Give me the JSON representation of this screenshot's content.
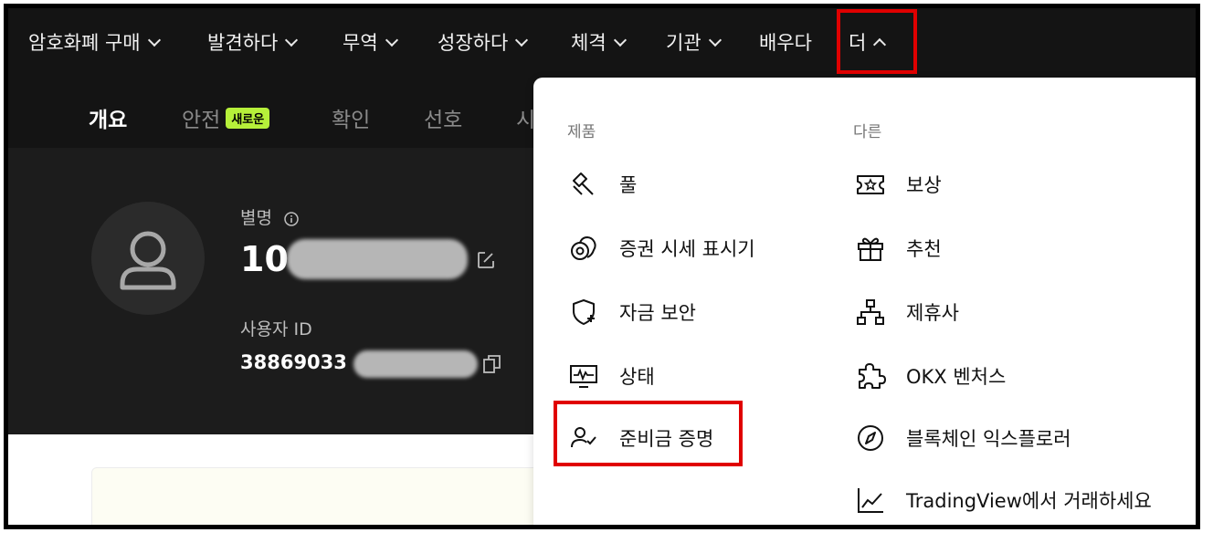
{
  "nav": {
    "items": [
      {
        "label": "암호화폐 구매",
        "chevron": "down"
      },
      {
        "label": "발견하다",
        "chevron": "down"
      },
      {
        "label": "무역",
        "chevron": "down"
      },
      {
        "label": "성장하다",
        "chevron": "down"
      },
      {
        "label": "체격",
        "chevron": "down"
      },
      {
        "label": "기관",
        "chevron": "down"
      },
      {
        "label": "배우다",
        "chevron": ""
      },
      {
        "label": "더",
        "chevron": "up"
      }
    ]
  },
  "subnav": {
    "tabs": [
      {
        "label": "개요",
        "active": true
      },
      {
        "label": "안전",
        "badge": "새로운"
      },
      {
        "label": "확인"
      },
      {
        "label": "선호"
      },
      {
        "label": "시"
      }
    ]
  },
  "profile": {
    "nickname_label": "별명",
    "nickname_value": "10",
    "user_id_label": "사용자 ID",
    "user_id_value": "38869033",
    "info_icon": "info-icon",
    "edit_icon": "edit-icon",
    "copy_icon": "copy-icon"
  },
  "dropdown": {
    "products_title": "제품",
    "other_title": "다른",
    "products": [
      {
        "label": "풀",
        "icon": "pickaxe-icon"
      },
      {
        "label": "증권 시세 표시기",
        "icon": "coins-icon"
      },
      {
        "label": "자금 보안",
        "icon": "shield-plus-icon"
      },
      {
        "label": "상태",
        "icon": "monitor-pulse-icon"
      },
      {
        "label": "준비금 증명",
        "icon": "user-check-icon"
      }
    ],
    "other": [
      {
        "label": "보상",
        "icon": "ticket-star-icon"
      },
      {
        "label": "추천",
        "icon": "gift-icon"
      },
      {
        "label": "제휴사",
        "icon": "network-icon"
      },
      {
        "label": "OKX 벤처스",
        "icon": "puzzle-icon"
      },
      {
        "label": "블록체인 익스플로러",
        "icon": "compass-icon"
      },
      {
        "label": "TradingView에서 거래하세요",
        "icon": "line-chart-icon"
      }
    ]
  },
  "colors": {
    "nav_bg": "#141414",
    "highlight_border": "#e00000",
    "badge_bg": "#b6f03a"
  }
}
